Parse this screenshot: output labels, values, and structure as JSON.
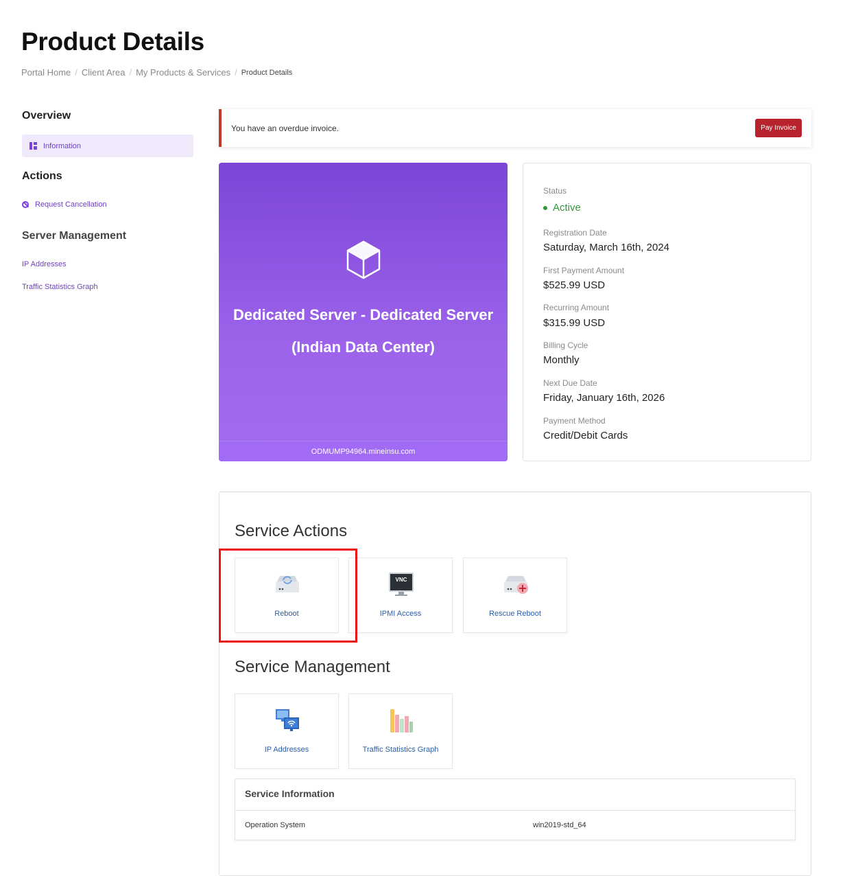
{
  "page": {
    "title": "Product Details",
    "breadcrumb": [
      "Portal Home",
      "Client Area",
      "My Products & Services",
      "Product Details"
    ]
  },
  "sidebar": {
    "overview_heading": "Overview",
    "overview_item": "Information",
    "actions_heading": "Actions",
    "actions_item": "Request Cancellation",
    "server_heading": "Server Management",
    "server_items": [
      "IP Addresses",
      "Traffic Statistics Graph"
    ]
  },
  "alert": {
    "message": "You have an overdue invoice.",
    "button": "Pay Invoice",
    "accent": "#c0392b"
  },
  "product": {
    "name": "Dedicated Server - Dedicated Server (Indian Data Center)",
    "hostname": "ODMUMP94964.mineinsu.com",
    "icon": "cube-icon",
    "accent": "#7b45d6"
  },
  "details": {
    "status_label": "Status",
    "status_value": "Active",
    "status_color": "#2e9b3a",
    "registration_label": "Registration Date",
    "registration_value": "Saturday, March 16th, 2024",
    "first_payment_label": "First Payment Amount",
    "first_payment_value": "$525.99 USD",
    "recurring_label": "Recurring Amount",
    "recurring_value": "$315.99 USD",
    "billing_label": "Billing Cycle",
    "billing_value": "Monthly",
    "next_due_label": "Next Due Date",
    "next_due_value": "Friday, January 16th, 2026",
    "payment_method_label": "Payment Method",
    "payment_method_value": "Credit/Debit Cards"
  },
  "service_actions": {
    "heading": "Service Actions",
    "tiles": [
      {
        "label": "Reboot",
        "icon": "server-reboot-icon"
      },
      {
        "label": "IPMI Access",
        "icon": "vnc-monitor-icon",
        "icon_text": "VNC"
      },
      {
        "label": "Rescue Reboot",
        "icon": "server-rescue-icon"
      }
    ]
  },
  "service_management": {
    "heading": "Service Management",
    "tiles": [
      {
        "label": "IP Addresses",
        "icon": "network-computers-icon"
      },
      {
        "label": "Traffic Statistics Graph",
        "icon": "bar-stats-icon"
      }
    ]
  },
  "service_info": {
    "heading": "Service Information",
    "rows": [
      {
        "key": "Operation System",
        "value": "win2019-std_64"
      }
    ]
  }
}
